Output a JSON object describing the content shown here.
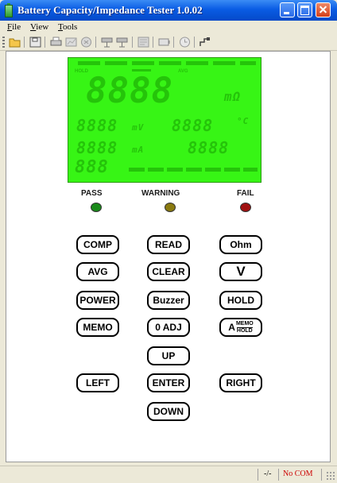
{
  "window": {
    "title": "Battery Capacity/Impedance Tester 1.0.02"
  },
  "menu": {
    "items": [
      "File",
      "View",
      "Tools"
    ]
  },
  "toolbar": {
    "buttons": [
      "open-folder-icon",
      "save-icon",
      "print-icon",
      "chart-icon",
      "stop-icon",
      "meter-icon",
      "meter2-icon",
      "report-icon",
      "battery-icon",
      "clock-icon",
      "connect-icon"
    ]
  },
  "lcd": {
    "main_digits": "8888",
    "main_unit": "mΩ",
    "mv_digits": "8888",
    "mv_unit": "mV",
    "temp_digits": "8888",
    "temp_unit": "°C",
    "ma_digits": "8888",
    "ma_unit": "mA",
    "right_digits": "8888",
    "bottom_digits": "888",
    "labels": {
      "hold": "HOLD",
      "avg": "AVG"
    },
    "color": "#37f515"
  },
  "indicators": [
    {
      "label": "PASS",
      "color": "#1a8a1a"
    },
    {
      "label": "WARNING",
      "color": "#8a7a10"
    },
    {
      "label": "FAIL",
      "color": "#a01010"
    }
  ],
  "keys": {
    "comp": "COMP",
    "read": "READ",
    "ohm": "Ohm",
    "avg": "AVG",
    "clear": "CLEAR",
    "v": "V",
    "power": "POWER",
    "buzzer": "Buzzer",
    "hold": "HOLD",
    "memo": "MEMO",
    "zero_adj": "0 ADJ",
    "a_main": "A",
    "a_top": "MEMO",
    "a_bottom": "HOLD",
    "up": "UP",
    "left": "LEFT",
    "enter": "ENTER",
    "right": "RIGHT",
    "down": "DOWN"
  },
  "status": {
    "pane1": "-/-",
    "pane2": "No COM",
    "pane2_color": "#cc0000"
  }
}
